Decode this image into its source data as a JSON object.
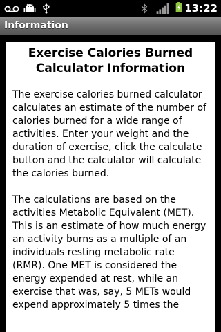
{
  "status_bar": {
    "time": "13:22",
    "icons": [
      "voicemail-icon",
      "android-debug-icon",
      "usb-icon",
      "bluetooth-icon",
      "signal-icon",
      "battery-charging-icon"
    ]
  },
  "title_bar": {
    "title": "Information"
  },
  "content": {
    "heading": "Exercise Calories Burned Calculator Information",
    "paragraphs": [
      "The exercise calories burned calculator calculates an estimate of the number of calories burned for a wide range of activities. Enter your weight and the duration of exercise, click the calculate button and the calculator will calculate the calories burned.",
      "The calculations are based on the activities Metabolic Equivalent (MET). This is an estimate of how much energy an activity burns as a multiple of an individuals resting metabolic rate (RMR). One MET is considered the energy expended at rest, while an exercise that was, say, 5 METs would expend approximately 5 times the"
    ]
  },
  "colors": {
    "background": "#000000",
    "panel": "#ffffff",
    "battery_green": "#8ec63f"
  }
}
